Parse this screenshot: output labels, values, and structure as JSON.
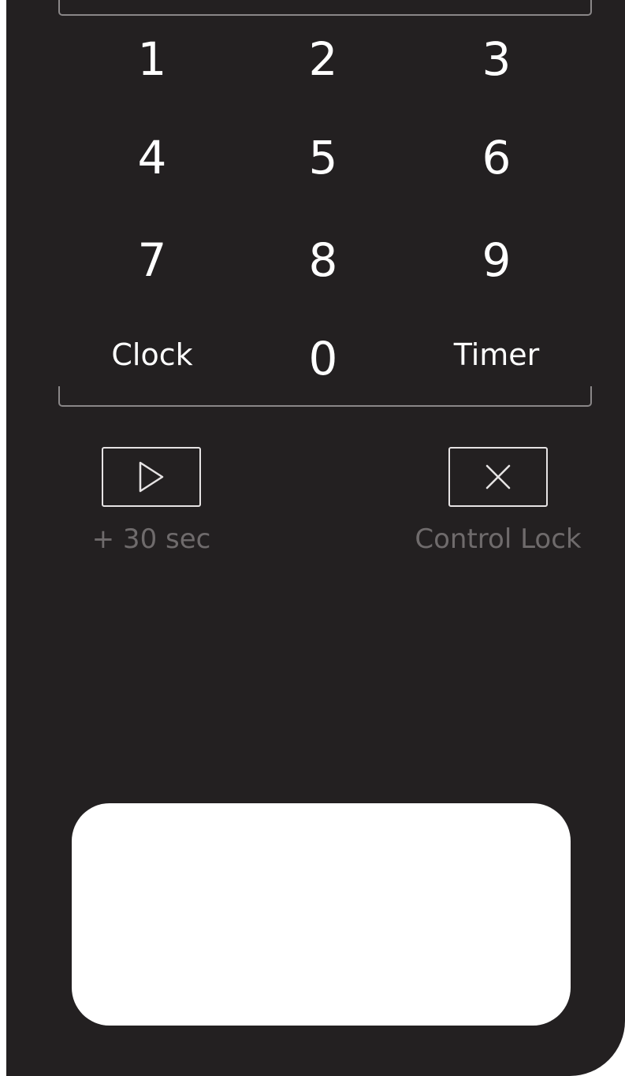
{
  "keypad": {
    "keys": [
      {
        "label": "1"
      },
      {
        "label": "2"
      },
      {
        "label": "3"
      },
      {
        "label": "4"
      },
      {
        "label": "5"
      },
      {
        "label": "6"
      },
      {
        "label": "7"
      },
      {
        "label": "8"
      },
      {
        "label": "9"
      },
      {
        "label": "Clock"
      },
      {
        "label": "0"
      },
      {
        "label": "Timer"
      }
    ]
  },
  "controls": {
    "start": {
      "icon": "play-icon",
      "caption": "+ 30 sec"
    },
    "stop": {
      "icon": "close-icon",
      "caption": "Control Lock"
    }
  },
  "display": {
    "text": ""
  },
  "colors": {
    "panel": "#232021",
    "key_text": "#ffffff",
    "caption_text": "#6f6b6c",
    "button_outline": "#e6e3e4",
    "display": "#ffffff"
  }
}
